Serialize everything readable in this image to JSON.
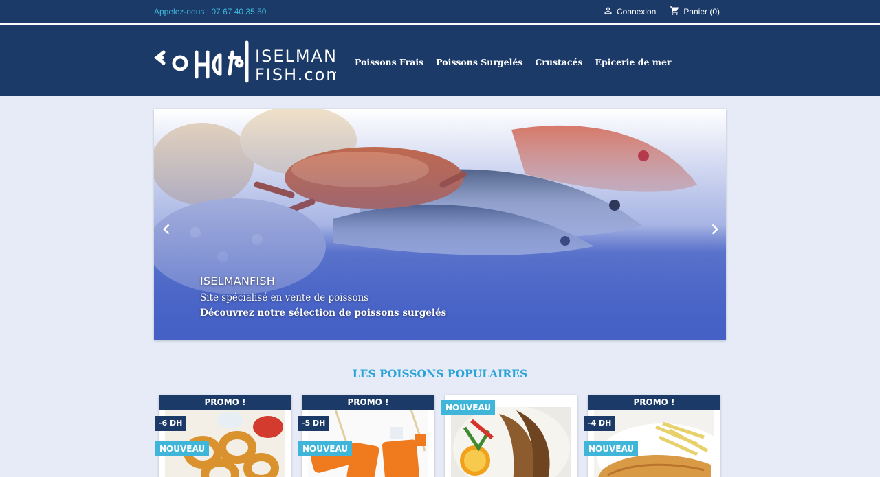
{
  "topbar": {
    "phone": "Appelez-nous : 07 67 40 35 50",
    "login_label": "Connexion",
    "cart_label": "Panier (0)",
    "icons": {
      "login": "person-icon",
      "cart": "shopping-cart-icon"
    }
  },
  "header": {
    "logo_text_line1": "ISELMAN",
    "logo_text_line2": "FISH.com",
    "nav": [
      {
        "label": "Poissons Frais"
      },
      {
        "label": "Poissons Surgelés"
      },
      {
        "label": "Crustacés"
      },
      {
        "label": "Epicerie de mer"
      }
    ]
  },
  "slider": {
    "title": "ISELMANFISH",
    "line1": "Site spécialisé en vente de poissons",
    "line2": "Découvrez notre sélection de poissons surgelés"
  },
  "section": {
    "title": "LES POISSONS POPULAIRES"
  },
  "products": [
    {
      "promo": "PROMO !",
      "discount": "-6 DH",
      "badge": "NOUVEAU"
    },
    {
      "promo": "PROMO !",
      "discount": "-5 DH",
      "badge": "NOUVEAU"
    },
    {
      "promo": "",
      "discount": "",
      "badge": "NOUVEAU"
    },
    {
      "promo": "PROMO !",
      "discount": "-4 DH",
      "badge": "NOUVEAU"
    }
  ],
  "colors": {
    "navy": "#1b3a68",
    "accent": "#3fb6d9",
    "title_blue": "#2aa3d6",
    "background": "#e6ebf7"
  }
}
